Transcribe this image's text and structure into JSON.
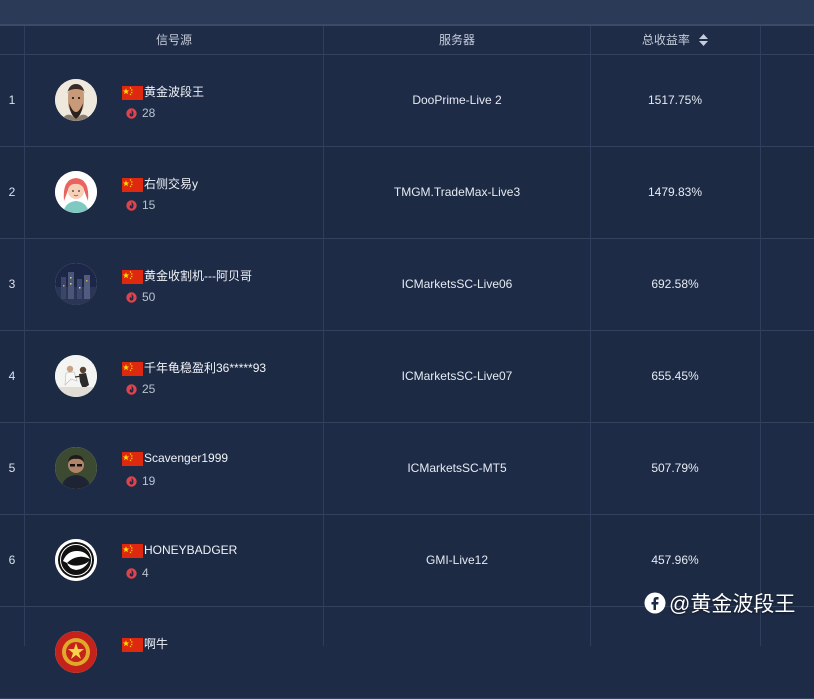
{
  "header": {
    "signal_source": "信号源",
    "server": "服务器",
    "total_return": "总收益率"
  },
  "colors": {
    "background": "#1d2a45",
    "header_bg": "#1f2c47",
    "divider": "#33425f",
    "fire": "#e0434b",
    "flag_red": "#de2910",
    "flag_star": "#ffde00"
  },
  "rows": [
    {
      "rank": "1",
      "name": "黄金波段王",
      "followers": "28",
      "server": "DooPrime-Live 2",
      "return": "1517.75%",
      "avatar": "bearded-man-illustration"
    },
    {
      "rank": "2",
      "name": "右侧交易y",
      "followers": "15",
      "server": "TMGM.TradeMax-Live3",
      "return": "1479.83%",
      "avatar": "cartoon-woman-red-hair"
    },
    {
      "rank": "3",
      "name": "黄金收割机---阿贝哥",
      "followers": "50",
      "server": "ICMarketsSC-Live06",
      "return": "692.58%",
      "avatar": "night-city-photo"
    },
    {
      "rank": "4",
      "name": "千年龟稳盈利36*****93",
      "followers": "25",
      "server": "ICMarketsSC-Live07",
      "return": "655.45%",
      "avatar": "martial-arts-photo"
    },
    {
      "rank": "5",
      "name": "Scavenger1999",
      "followers": "19",
      "server": "ICMarketsSC-MT5",
      "return": "507.79%",
      "avatar": "man-portrait-photo"
    },
    {
      "rank": "6",
      "name": "HONEYBADGER",
      "followers": "4",
      "server": "GMI-Live12",
      "return": "457.96%",
      "avatar": "honey-badger-logo"
    },
    {
      "rank": "",
      "name": "啊牛",
      "followers": "",
      "server": "",
      "return": "",
      "avatar": "red-gold-emblem"
    }
  ],
  "watermark": {
    "text": "@黄金波段王",
    "icon": "platform-logo-icon"
  }
}
